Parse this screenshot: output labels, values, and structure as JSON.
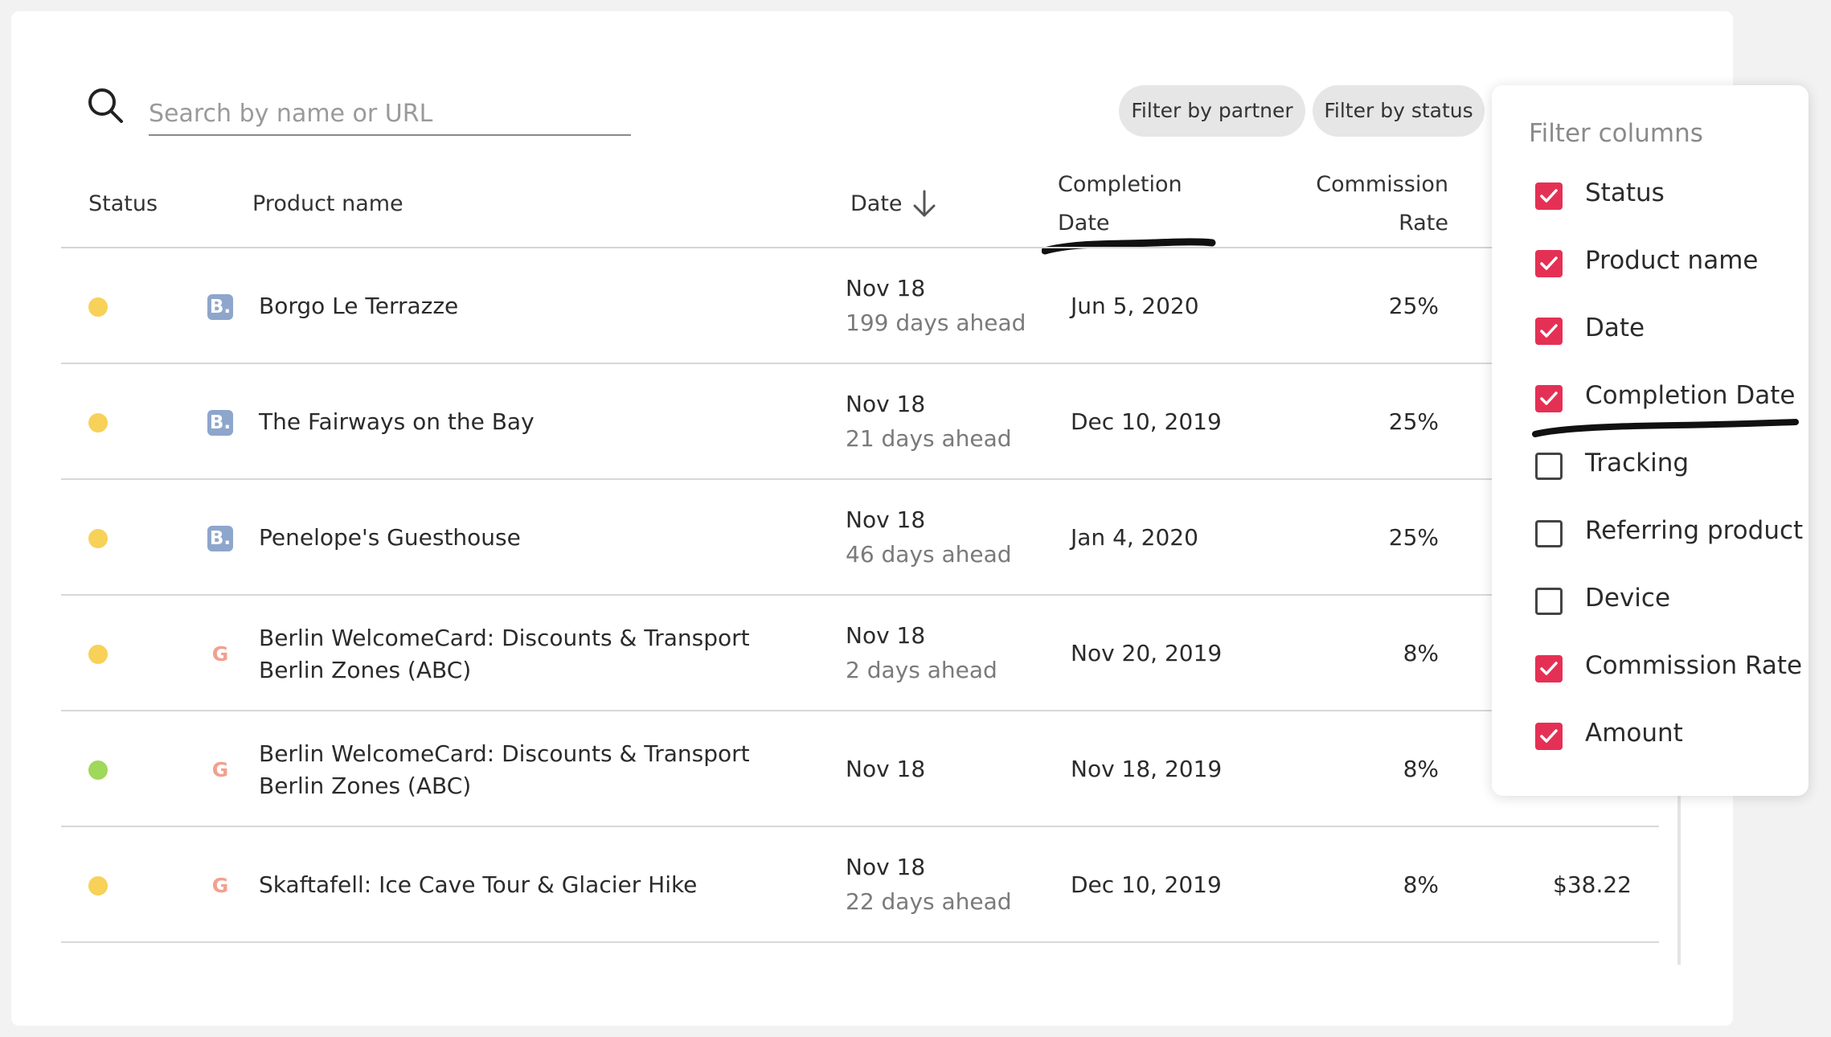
{
  "search": {
    "placeholder": "Search by name or URL",
    "value": ""
  },
  "filters": {
    "partner_label": "Filter by partner",
    "status_label": "Filter by status"
  },
  "table": {
    "headers": {
      "status": "Status",
      "product": "Product name",
      "date": "Date",
      "completion_line1": "Completion",
      "completion_line2": "Date",
      "commission_line1": "Commission",
      "commission_line2": "Rate"
    },
    "rows": [
      {
        "status_color": "#f7d158",
        "source_icon": "booking-b-icon",
        "source_glyph": "B.",
        "name": "Borgo Le Terrazze",
        "date": "Nov 18",
        "ahead": "199 days ahead",
        "completion": "Jun 5, 2020",
        "rate": "25%",
        "amount": ""
      },
      {
        "status_color": "#f7d158",
        "source_icon": "booking-b-icon",
        "source_glyph": "B.",
        "name": "The Fairways on the Bay",
        "date": "Nov 18",
        "ahead": "21 days ahead",
        "completion": "Dec 10, 2019",
        "rate": "25%",
        "amount": ""
      },
      {
        "status_color": "#f7d158",
        "source_icon": "booking-b-icon",
        "source_glyph": "B.",
        "name": "Penelope's Guesthouse",
        "date": "Nov 18",
        "ahead": "46 days ahead",
        "completion": "Jan 4, 2020",
        "rate": "25%",
        "amount": ""
      },
      {
        "status_color": "#f7d158",
        "source_icon": "getyourguide-g-icon",
        "source_glyph": "G",
        "name": "Berlin WelcomeCard: Discounts & Transport Berlin Zones (ABC)",
        "date": "Nov 18",
        "ahead": "2 days ahead",
        "completion": "Nov 20, 2019",
        "rate": "8%",
        "amount": ""
      },
      {
        "status_color": "#9fd85a",
        "source_icon": "getyourguide-g-icon",
        "source_glyph": "G",
        "name": "Berlin WelcomeCard: Discounts & Transport Berlin Zones (ABC)",
        "date": "Nov 18",
        "ahead": "",
        "completion": "Nov 18, 2019",
        "rate": "8%",
        "amount": ""
      },
      {
        "status_color": "#f7d158",
        "source_icon": "getyourguide-g-icon",
        "source_glyph": "G",
        "name": "Skaftafell: Ice Cave Tour & Glacier Hike",
        "date": "Nov 18",
        "ahead": "22 days ahead",
        "completion": "Dec 10, 2019",
        "rate": "8%",
        "amount": "$38.22"
      }
    ]
  },
  "column_filter": {
    "title": "Filter columns",
    "options": [
      {
        "label": "Status",
        "checked": true
      },
      {
        "label": "Product name",
        "checked": true
      },
      {
        "label": "Date",
        "checked": true
      },
      {
        "label": "Completion Date",
        "checked": true
      },
      {
        "label": "Tracking",
        "checked": false
      },
      {
        "label": "Referring product",
        "checked": false
      },
      {
        "label": "Device",
        "checked": false
      },
      {
        "label": "Commission Rate",
        "checked": true
      },
      {
        "label": "Amount",
        "checked": true
      }
    ]
  },
  "colors": {
    "checkbox_on": "#e53055",
    "annotation_ink": "#111111"
  },
  "icons": {
    "search": "search-icon",
    "sort": "arrow-down-icon",
    "check": "checkmark-icon"
  }
}
